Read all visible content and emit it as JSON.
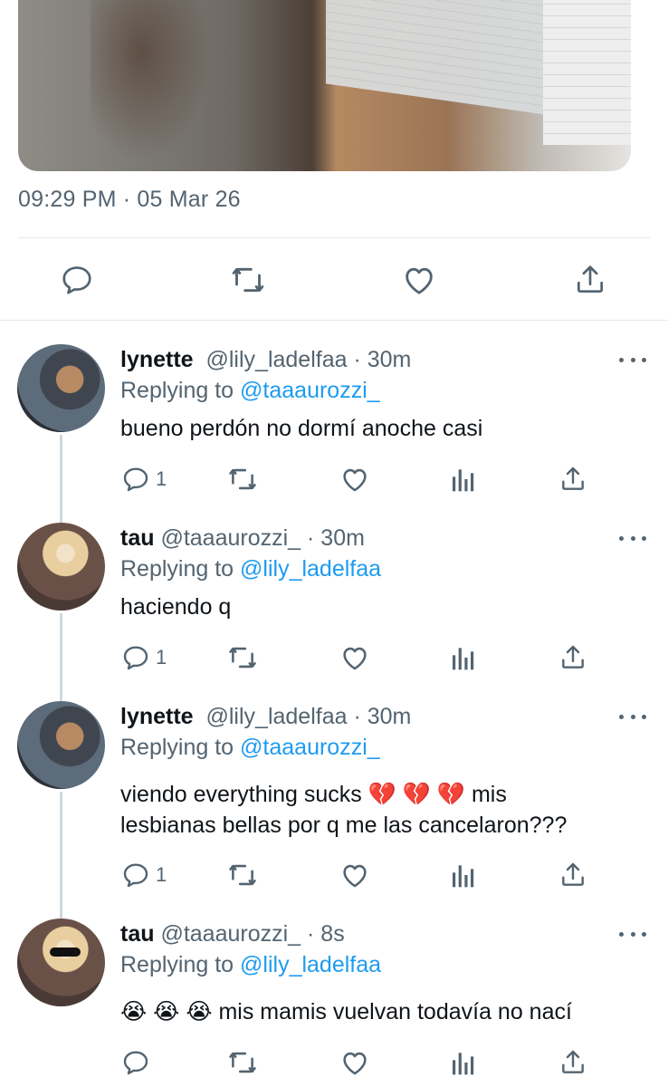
{
  "tweet": {
    "timestamp": "09:29 PM · 05 Mar 26"
  },
  "replies": [
    {
      "name": "lynette",
      "handle": "@lily_ladelfaa · 30m",
      "replying_prefix": "Replying to ",
      "replying_to": "@taaaurozzi_",
      "text_lines": [
        "bueno perdón no dormí anoche casi"
      ],
      "reply_count": "1"
    },
    {
      "name": "tau",
      "handle": "@taaaurozzi_ · 30m",
      "replying_prefix": "Replying to ",
      "replying_to": "@lily_ladelfaa",
      "text_lines": [
        "haciendo q"
      ],
      "reply_count": "1"
    },
    {
      "name": "lynette",
      "handle": "@lily_ladelfaa · 30m",
      "replying_prefix": "Replying to ",
      "replying_to": "@taaaurozzi_",
      "text_lines": [
        "viendo everything sucks 💔 💔 💔 mis",
        "lesbianas bellas por q me las cancelaron???"
      ],
      "reply_count": "1"
    },
    {
      "name": "tau",
      "handle": "@taaaurozzi_ · 8s",
      "replying_prefix": "Replying to ",
      "replying_to": "@lily_ladelfaa",
      "text_lines": [
        "😭 😭 😭  mis mamis vuelvan todavía no nací"
      ],
      "reply_count": ""
    }
  ],
  "icons": {
    "reply": "reply-icon",
    "retweet": "retweet-icon",
    "like": "heart-icon",
    "views": "views-icon",
    "share": "share-icon",
    "more": "more-icon"
  },
  "colors": {
    "link": "#1d9bf0",
    "secondary_text": "#536471",
    "primary_text": "#0f1419",
    "divider": "#e6e9eb"
  }
}
